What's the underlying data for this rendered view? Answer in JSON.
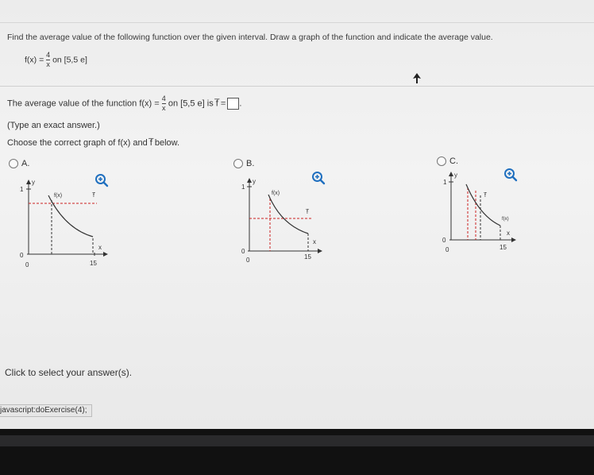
{
  "problem": {
    "instructions": "Find the average value of the following function over the given interval. Draw a graph of the function and indicate the average value.",
    "function_lhs": "f(x) =",
    "function_num": "4",
    "function_den": "x",
    "interval": "on [5,5 e]"
  },
  "question": {
    "prefix": "The average value of the function f(x) =",
    "num": "4",
    "den": "x",
    "suffix": "on [5,5 e] is f̅ =",
    "answer_value": "",
    "period": ".",
    "hint": "(Type an exact answer.)",
    "choose": "Choose the correct graph of f(x) and f̅ below."
  },
  "options": [
    {
      "id": "A",
      "label": "A.",
      "selected": false
    },
    {
      "id": "B",
      "label": "B.",
      "selected": false
    },
    {
      "id": "C",
      "label": "C.",
      "selected": false
    }
  ],
  "graph_labels": {
    "y_axis": "y",
    "x_axis": "x",
    "y_tick": "1",
    "origin_x": "0",
    "origin_y": "0",
    "x_tick": "15",
    "fx": "f(x)",
    "fbar": "f̅"
  },
  "footer": {
    "prompt": "Click to select your answer(s).",
    "status": "javascript:doExercise(4);"
  },
  "icons": [
    "zoom-in-icon",
    "radio-icon",
    "cursor-arrow-icon"
  ],
  "colors": {
    "curve": "#333333",
    "dashed_red": "#cc2222",
    "zoom_icon": "#1f6fbf"
  }
}
